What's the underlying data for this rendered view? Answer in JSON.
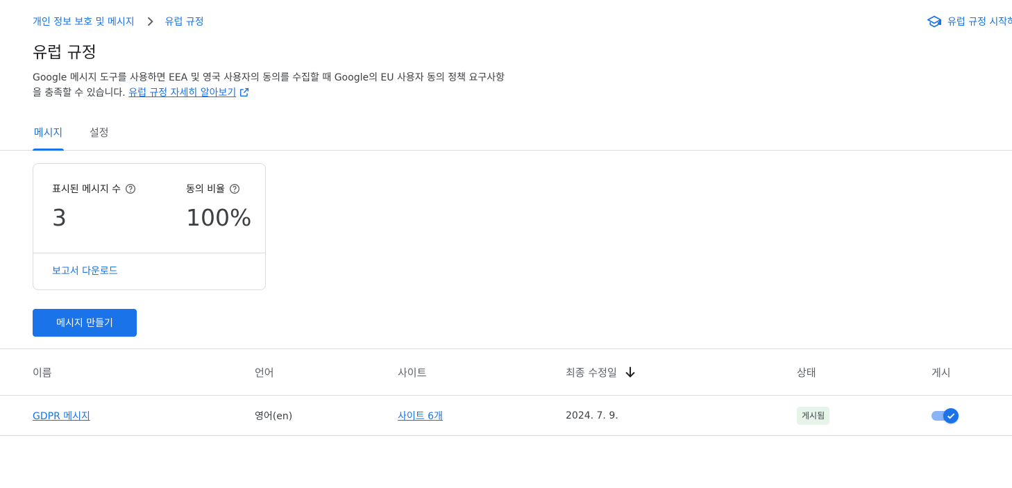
{
  "breadcrumb": {
    "parent": "개인 정보 보호 및 메시지",
    "current": "유럽 규정"
  },
  "header": {
    "guide_label": "유럽 규정 시작하기",
    "guide_icon": "school-icon",
    "title": "유럽 규정",
    "description": "Google 메시지 도구를 사용하면 EEA 및 영국 사용자의 동의를 수집할 때 Google의 EU 사용자 동의 정책 요구사항을 충족할 수 있습니다.",
    "learn_more": "유럽 규정 자세히 알아보기"
  },
  "tabs": [
    {
      "label": "메시지",
      "active": true
    },
    {
      "label": "설정",
      "active": false
    }
  ],
  "stats": {
    "shown_label": "표시된 메시지 수",
    "shown_value": "3",
    "consent_label": "동의 비율",
    "consent_value": "100%",
    "download_label": "보고서 다운로드"
  },
  "create_button": "메시지 만들기",
  "table": {
    "columns": {
      "name": "이름",
      "language": "언어",
      "sites": "사이트",
      "modified": "최종 수정일",
      "status": "상태",
      "publish": "게시"
    },
    "sort": {
      "column": "modified",
      "direction": "descending"
    },
    "rows": [
      {
        "name": "GDPR 메시지",
        "language": "영어(en)",
        "sites": "사이트 6개",
        "modified": "2024. 7. 9.",
        "status": "게시됨",
        "published": true
      }
    ]
  },
  "colors": {
    "accent": "#1a73e8",
    "status_bg": "#e6f4ea",
    "divider": "#dadce0"
  }
}
